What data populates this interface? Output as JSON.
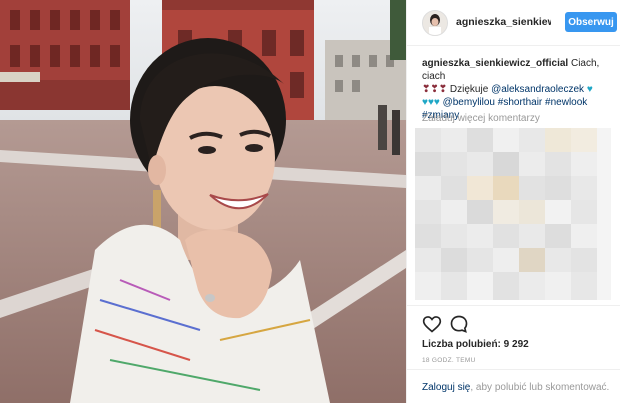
{
  "header": {
    "username": "agnieszka_sienkiewicz",
    "follow_label": "Obserwuj"
  },
  "caption": {
    "username": "agnieszka_sienkiewicz_official",
    "text": "Ciach, ciach",
    "x_hearts": "❣❣❣",
    "thanks": "Dziękuje",
    "mention1": "@aleksandraoleczek",
    "blue_hearts": "♥♥♥",
    "mention2": "@bemylilou",
    "tag1": "#shorthair",
    "tag2": "#newlook",
    "tag3": "#zmiany"
  },
  "load_more": "Załaduj więcej komentarzy",
  "likes": "Liczba polubień: 9 292",
  "time_ago": "18 GODZ. TEMU",
  "login": {
    "link": "Zaloguj się",
    "text": ", aby polubić lub skomentować."
  },
  "icons": {
    "like": "heart-icon",
    "comment": "comment-bubble-icon"
  },
  "colors": {
    "accent": "#3897f0",
    "link": "#003569",
    "muted": "#999999"
  }
}
